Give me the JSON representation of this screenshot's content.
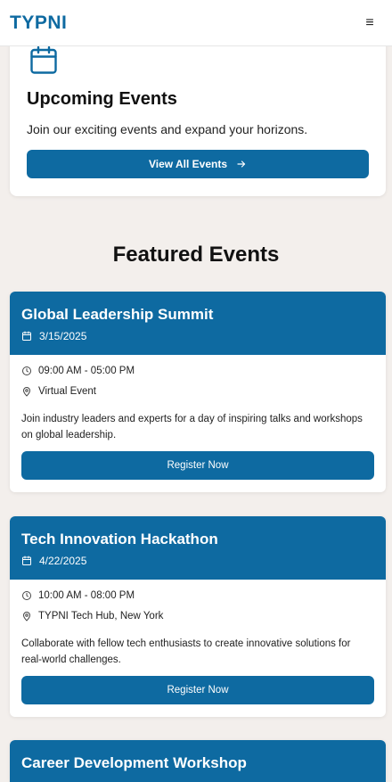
{
  "header": {
    "brand": "TYPNI",
    "menu_icon": "≡"
  },
  "intro": {
    "icon": "calendar-icon",
    "title": "Upcoming Events",
    "text": "Join our exciting events and expand your horizons.",
    "button_label": "View All Events"
  },
  "featured": {
    "title": "Featured Events",
    "events": [
      {
        "title": "Global Leadership Summit",
        "date": "3/15/2025",
        "time": "09:00 AM - 05:00 PM",
        "location": "Virtual Event",
        "description": "Join industry leaders and experts for a day of inspiring talks and workshops on global leadership.",
        "button_label": "Register Now"
      },
      {
        "title": "Tech Innovation Hackathon",
        "date": "4/22/2025",
        "time": "10:00 AM - 08:00 PM",
        "location": "TYPNI Tech Hub, New York",
        "description": "Collaborate with fellow tech enthusiasts to create innovative solutions for real-world challenges.",
        "button_label": "Register Now"
      },
      {
        "title": "Career Development Workshop"
      }
    ]
  },
  "colors": {
    "primary": "#0e6aa1",
    "page_bg": "#f3efec"
  }
}
